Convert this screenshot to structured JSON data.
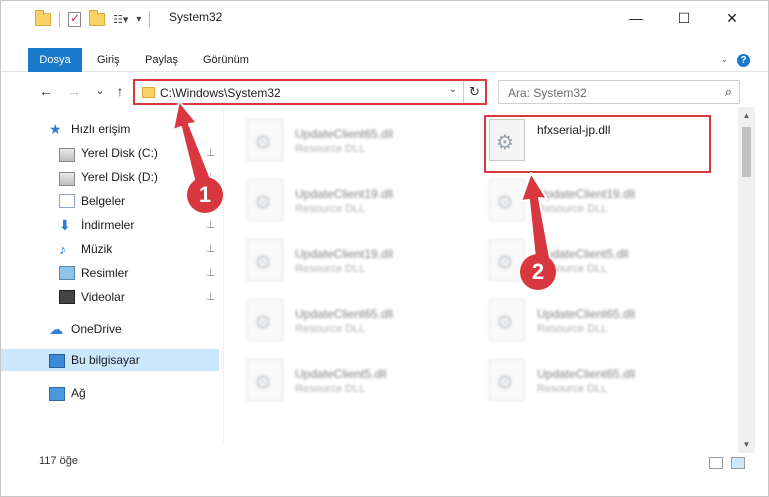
{
  "window": {
    "title": "System32",
    "controls": {
      "minimize": "—",
      "maximize": "☐",
      "close": "✕"
    }
  },
  "ribbon": {
    "tabs": [
      {
        "label": "Dosya",
        "active": true
      },
      {
        "label": "Giriş"
      },
      {
        "label": "Paylaş"
      },
      {
        "label": "Görünüm"
      }
    ],
    "help": "?"
  },
  "nav": {
    "back": "←",
    "forward": "→",
    "recent": "⌄",
    "up": "↑",
    "address": "C:\\Windows\\System32",
    "refresh": "↻",
    "search_placeholder": "Ara: System32",
    "search_icon": "⌕"
  },
  "sidebar": {
    "items": [
      {
        "label": "Hızlı erişim",
        "icon": "star-icon"
      },
      {
        "label": "Yerel Disk (C:)",
        "icon": "disk-icon",
        "pinned": true
      },
      {
        "label": "Yerel Disk (D:)",
        "icon": "disk-icon",
        "pinned": true
      },
      {
        "label": "Belgeler",
        "icon": "documents-icon",
        "pinned": true
      },
      {
        "label": "İndirmeler",
        "icon": "download-icon",
        "pinned": true
      },
      {
        "label": "Müzik",
        "icon": "music-icon",
        "pinned": true
      },
      {
        "label": "Resimler",
        "icon": "pictures-icon",
        "pinned": true
      },
      {
        "label": "Videolar",
        "icon": "videos-icon",
        "pinned": true
      },
      {
        "label": "OneDrive",
        "icon": "cloud-icon"
      },
      {
        "label": "Bu bilgisayar",
        "icon": "computer-icon",
        "selected": true
      },
      {
        "label": "Ağ",
        "icon": "network-icon"
      }
    ],
    "pin_glyph": "📌"
  },
  "files": [
    {
      "name": "UpdateClient65.dll",
      "type": "Resource DLL"
    },
    {
      "name": "hfxserial-jp.dll",
      "type": ""
    },
    {
      "name": "UpdateClient19.dll",
      "type": "Resource DLL"
    },
    {
      "name": "UpdateClient19.dll",
      "type": "Resource DLL"
    },
    {
      "name": "UpdateClient19.dll",
      "type": "Resource DLL"
    },
    {
      "name": "UpdateClient5.dll",
      "type": "Resource DLL"
    },
    {
      "name": "UpdateClient65.dll",
      "type": "Resource DLL"
    },
    {
      "name": "UpdateClient65.dll",
      "type": "Resource DLL"
    },
    {
      "name": "UpdateClient5.dll",
      "type": "Resource DLL"
    },
    {
      "name": "UpdateClient65.dll",
      "type": "Resource DLL"
    }
  ],
  "status": {
    "item_count": "117 öğe"
  },
  "annotations": {
    "step1": "1",
    "step2": "2",
    "color": "#d9373f"
  }
}
